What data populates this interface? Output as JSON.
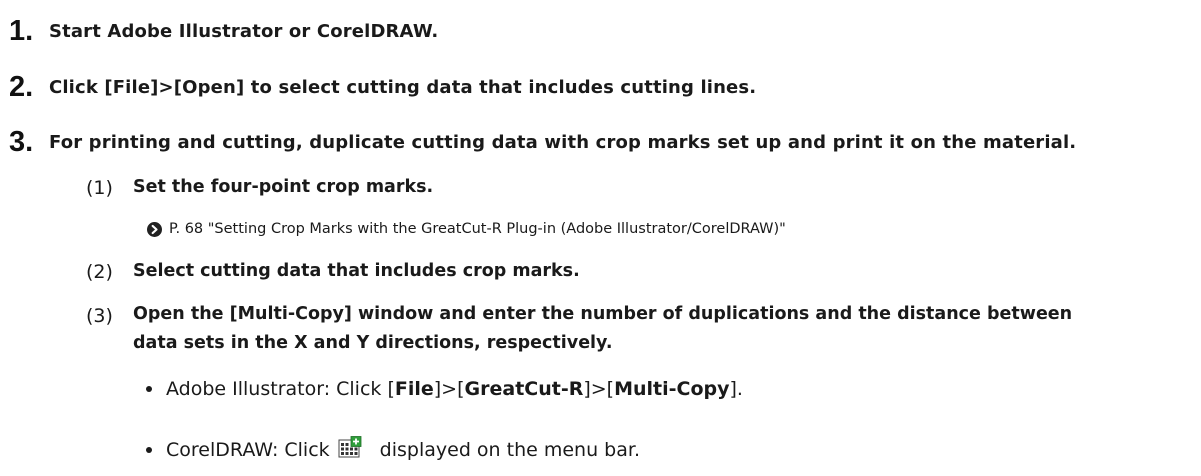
{
  "steps": [
    {
      "number": "1.",
      "text": "Start Adobe Illustrator or CorelDRAW."
    },
    {
      "number": "2.",
      "text": "Click [File]>[Open] to select cutting data that includes cutting lines."
    },
    {
      "number": "3.",
      "text": "For printing and cutting, duplicate cutting data with crop marks set up and print it on the material."
    }
  ],
  "substeps": [
    {
      "number": "(1)",
      "text": "Set the four-point crop marks."
    },
    {
      "number": "(2)",
      "text": "Select cutting data that includes crop marks."
    },
    {
      "number": "(3)",
      "line1": "Open the [Multi-Copy] window and enter the number of duplications and the distance between",
      "line2": "data sets in the X and Y directions, respectively."
    }
  ],
  "reference": {
    "icon": "arrow-circle-icon",
    "text": "P. 68 \"Setting Crop Marks with the GreatCut-R Plug-in (Adobe Illustrator/CorelDRAW)\""
  },
  "bullets": {
    "illustrator": {
      "prefix": "Adobe Illustrator: Click [",
      "file": "File",
      "sep1": "]>[",
      "greatcut": "GreatCut-R",
      "sep2": "]>[",
      "multicopy": "Multi-Copy",
      "suffix": "]."
    },
    "coreldraw": {
      "prefix": "CorelDRAW: Click",
      "icon": "multi-copy-icon",
      "suffix": "displayed on the menu bar."
    }
  }
}
